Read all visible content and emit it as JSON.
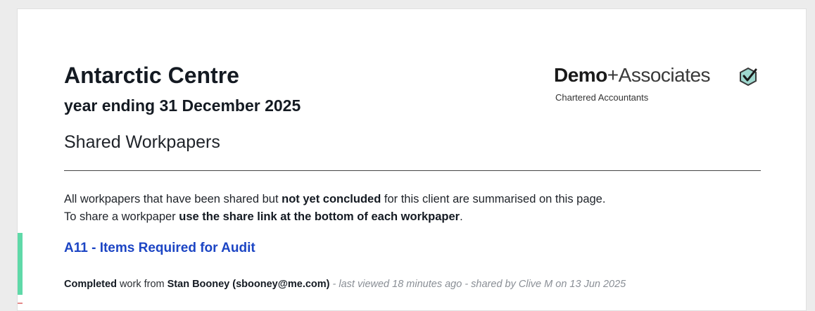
{
  "header": {
    "client_name": "Antarctic Centre",
    "period": "year ending 31 December 2025",
    "section_title": "Shared Workpapers"
  },
  "logo": {
    "brand_bold": "Demo",
    "brand_light": "+Associates",
    "subtitle": "Chartered Accountants",
    "icon": "check-badge-icon"
  },
  "intro": {
    "line1_a": "All workpapers that have been shared but ",
    "line1_b": "not yet concluded",
    "line1_c": " for this client are summarised on this page.",
    "line2_a": "To share a workpaper ",
    "line2_b": "use the share link at the bottom of each workpaper",
    "line2_c": "."
  },
  "workpapers": [
    {
      "title": "A11 - Items Required for Audit",
      "status": "Completed",
      "from_label": " work from ",
      "from_user": "Stan Booney (sbooney@me.com)",
      "details": " - last viewed 18 minutes ago - shared by Clive M on 13 Jun 2025"
    }
  ],
  "colors": {
    "accent_completed": "#5fd9a8",
    "link": "#1c45c4",
    "muted": "#8a8f96"
  }
}
